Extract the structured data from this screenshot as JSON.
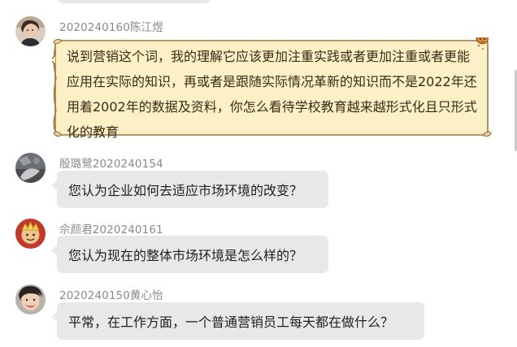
{
  "messages": [
    {
      "sender": "2020240160陈江煜",
      "text": "说到营销这个词，我的理解它应该更加注重实践或者更加注重或者更能应用在实际的知识，再或者是跟随实际情况革新的知识而不是2022年还用着2002年的数据及资料，你怎么看待学校教育越来越形式化且只形式化的教育",
      "bubble_style": "parchment-scroll",
      "avatar": "avatar-photo-girl"
    },
    {
      "sender": "殷璐鹭2020240154",
      "text": "您认为企业如何去适应市场环境的改变？",
      "bubble_style": "gray",
      "avatar": "avatar-photo-dark"
    },
    {
      "sender": "佘颜君2020240161",
      "text": "您认为现在的整体市场环境是怎么样的？",
      "bubble_style": "gray",
      "avatar": "avatar-cartoon-red"
    },
    {
      "sender": "2020240150黄心怡",
      "text": "平常，在工作方面，一个普通营销员工每天都在做什么？",
      "bubble_style": "gray",
      "avatar": "avatar-photo-face"
    }
  ],
  "colors": {
    "bubble_gray": "#e8e8e8",
    "scroll_fill": "#fbf0c6",
    "scroll_border": "#a0783f",
    "name_gray": "#8a8a8a"
  }
}
